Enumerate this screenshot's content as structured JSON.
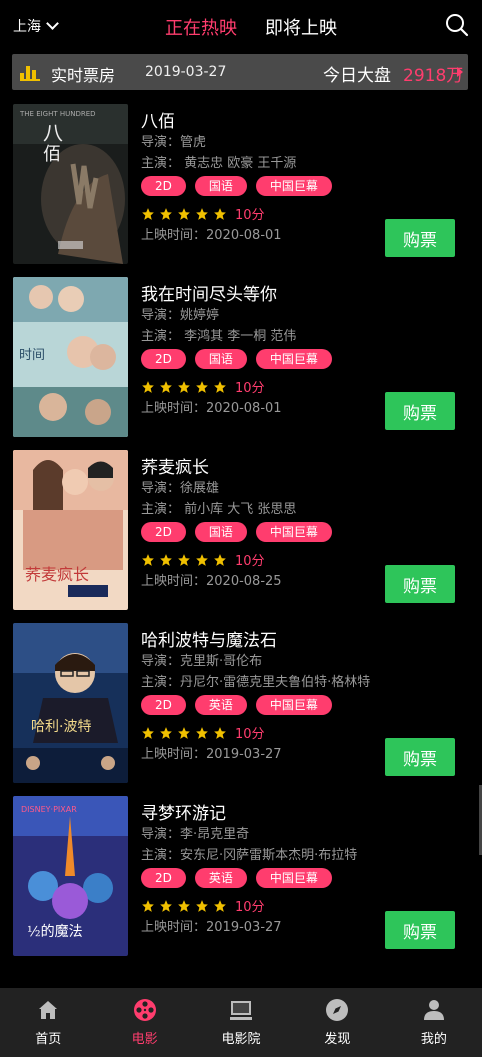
{
  "header": {
    "city": "上海",
    "tabs": [
      {
        "label": "正在热映",
        "active": true
      },
      {
        "label": "即将上映",
        "active": false
      }
    ]
  },
  "boxoffice": {
    "label": "实时票房",
    "date": "2019-03-27",
    "total_label": "今日大盘",
    "total_value": "2918万"
  },
  "movies": [
    {
      "title": "八佰",
      "director": "导演：管虎",
      "cast": "主演：   黄志忠   欧豪   王千源",
      "tags": [
        "2D",
        "国语",
        "中国巨幕"
      ],
      "score": "10分",
      "release": "上映时间：2020-08-01",
      "buy_label": "购票",
      "poster_text": "THE EIGHT HUNDRED"
    },
    {
      "title": "我在时间尽头等你",
      "director": "导演：姚婷婷",
      "cast": "主演：   李鸿其   李一桐   范伟",
      "tags": [
        "2D",
        "国语",
        "中国巨幕"
      ],
      "score": "10分",
      "release": "上映时间：2020-08-01",
      "buy_label": "购票",
      "poster_text": ""
    },
    {
      "title": "荞麦疯长",
      "director": "导演：徐展雄",
      "cast": "主演：   前小库   大飞   张思思",
      "tags": [
        "2D",
        "国语",
        "中国巨幕"
      ],
      "score": "10分",
      "release": "上映时间：2020-08-25",
      "buy_label": "购票",
      "poster_text": ""
    },
    {
      "title": "哈利波特与魔法石",
      "director": "导演：克里斯·哥伦布",
      "cast": "主演：丹尼尔·雷德克里夫鲁伯特·格林特",
      "tags": [
        "2D",
        "英语",
        "中国巨幕"
      ],
      "score": "10分",
      "release": "上映时间：2019-03-27",
      "buy_label": "购票",
      "poster_text": ""
    },
    {
      "title": "寻梦环游记",
      "director": "导演：李·昂克里奇",
      "cast": "主演：安东尼·冈萨雷斯本杰明·布拉特",
      "tags": [
        "2D",
        "英语",
        "中国巨幕"
      ],
      "score": "10分",
      "release": "上映时间：2019-03-27",
      "buy_label": "购票",
      "poster_text": ""
    }
  ],
  "nav": [
    {
      "label": "首页",
      "icon": "home-icon",
      "active": false
    },
    {
      "label": "电影",
      "icon": "film-reel-icon",
      "active": true
    },
    {
      "label": "电影院",
      "icon": "cinema-screen-icon",
      "active": false
    },
    {
      "label": "发现",
      "icon": "compass-icon",
      "active": false
    },
    {
      "label": "我的",
      "icon": "user-icon",
      "active": false
    }
  ],
  "colors": {
    "accent": "#ff3d6e",
    "buy_button": "#2ec55a",
    "star": "#f0c000",
    "boxbar_bg": "#4a4a4a"
  }
}
